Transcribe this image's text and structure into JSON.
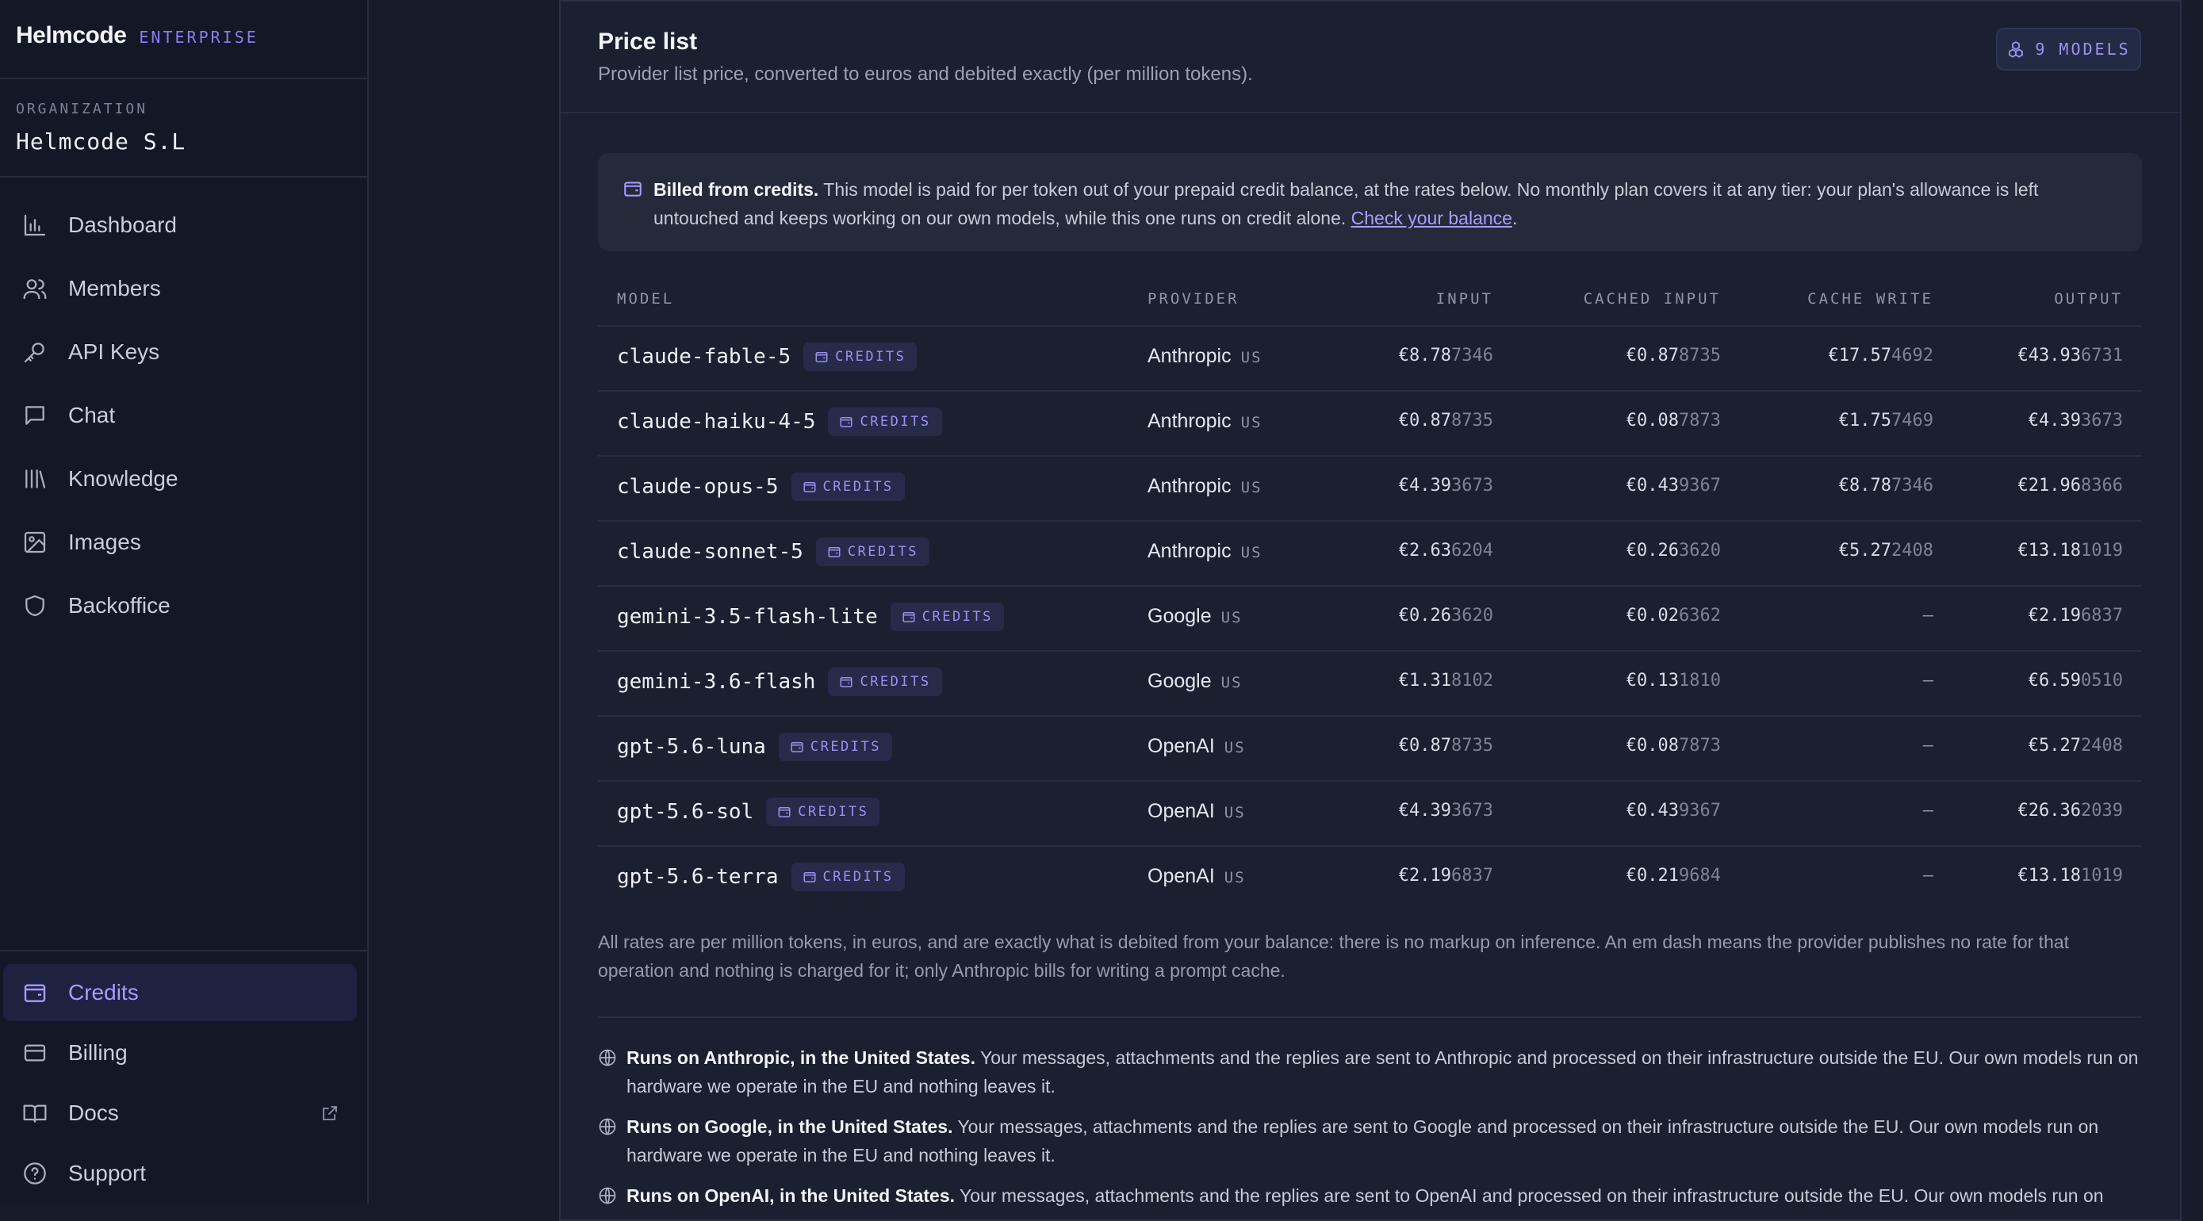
{
  "brand": {
    "name": "Helmcode",
    "tier": "ENTERPRISE"
  },
  "org": {
    "label": "ORGANIZATION",
    "name": "Helmcode S.L"
  },
  "nav": {
    "dashboard": "Dashboard",
    "members": "Members",
    "api_keys": "API Keys",
    "chat": "Chat",
    "knowledge": "Knowledge",
    "images": "Images",
    "backoffice": "Backoffice",
    "credits": "Credits",
    "billing": "Billing",
    "docs": "Docs",
    "support": "Support"
  },
  "colors": {
    "accent": "#a79bff",
    "background": "#161b29",
    "sidebar": "#121826",
    "panel": "#1b2030"
  },
  "price_list": {
    "title": "Price list",
    "subtitle": "Provider list price, converted to euros and debited exactly (per million tokens).",
    "models_badge": "9 MODELS",
    "notice": {
      "bold": "Billed from credits.",
      "text": " This model is paid for per token out of your prepaid credit balance, at the rates below. No monthly plan covers it at any tier: your plan's allowance is left untouched and keeps working on our own models, while this one runs on credit alone. ",
      "link": "Check your balance",
      "end": "."
    },
    "columns": {
      "model": "MODEL",
      "provider": "PROVIDER",
      "input": "INPUT",
      "cached_input": "CACHED INPUT",
      "cache_write": "CACHE WRITE",
      "output": "OUTPUT"
    },
    "badge_label": "CREDITS",
    "rows": [
      {
        "model": "claude-fable-5",
        "provider": "Anthropic",
        "region": "US",
        "input": [
          "€8.78",
          "7346"
        ],
        "cached": [
          "€0.87",
          "8735"
        ],
        "write": [
          "€17.57",
          "4692"
        ],
        "output": [
          "€43.93",
          "6731"
        ]
      },
      {
        "model": "claude-haiku-4-5",
        "provider": "Anthropic",
        "region": "US",
        "input": [
          "€0.87",
          "8735"
        ],
        "cached": [
          "€0.08",
          "7873"
        ],
        "write": [
          "€1.75",
          "7469"
        ],
        "output": [
          "€4.39",
          "3673"
        ]
      },
      {
        "model": "claude-opus-5",
        "provider": "Anthropic",
        "region": "US",
        "input": [
          "€4.39",
          "3673"
        ],
        "cached": [
          "€0.43",
          "9367"
        ],
        "write": [
          "€8.78",
          "7346"
        ],
        "output": [
          "€21.96",
          "8366"
        ]
      },
      {
        "model": "claude-sonnet-5",
        "provider": "Anthropic",
        "region": "US",
        "input": [
          "€2.63",
          "6204"
        ],
        "cached": [
          "€0.26",
          "3620"
        ],
        "write": [
          "€5.27",
          "2408"
        ],
        "output": [
          "€13.18",
          "1019"
        ]
      },
      {
        "model": "gemini-3.5-flash-lite",
        "provider": "Google",
        "region": "US",
        "input": [
          "€0.26",
          "3620"
        ],
        "cached": [
          "€0.02",
          "6362"
        ],
        "write": null,
        "output": [
          "€2.19",
          "6837"
        ]
      },
      {
        "model": "gemini-3.6-flash",
        "provider": "Google",
        "region": "US",
        "input": [
          "€1.31",
          "8102"
        ],
        "cached": [
          "€0.13",
          "1810"
        ],
        "write": null,
        "output": [
          "€6.59",
          "0510"
        ]
      },
      {
        "model": "gpt-5.6-luna",
        "provider": "OpenAI",
        "region": "US",
        "input": [
          "€0.87",
          "8735"
        ],
        "cached": [
          "€0.08",
          "7873"
        ],
        "write": null,
        "output": [
          "€5.27",
          "2408"
        ]
      },
      {
        "model": "gpt-5.6-sol",
        "provider": "OpenAI",
        "region": "US",
        "input": [
          "€4.39",
          "3673"
        ],
        "cached": [
          "€0.43",
          "9367"
        ],
        "write": null,
        "output": [
          "€26.36",
          "2039"
        ]
      },
      {
        "model": "gpt-5.6-terra",
        "provider": "OpenAI",
        "region": "US",
        "input": [
          "€2.19",
          "6837"
        ],
        "cached": [
          "€0.21",
          "9684"
        ],
        "write": null,
        "output": [
          "€13.18",
          "1019"
        ]
      }
    ],
    "dash": "—",
    "footnote": "All rates are per million tokens, in euros, and are exactly what is debited from your balance: there is no markup on inference. An em dash means the provider publishes no rate for that operation and nothing is charged for it; only Anthropic bills for writing a prompt cache.",
    "regions": [
      {
        "bold": "Runs on Anthropic, in the United States.",
        "text": " Your messages, attachments and the replies are sent to Anthropic and processed on their infrastructure outside the EU. Our own models run on hardware we operate in the EU and nothing leaves it."
      },
      {
        "bold": "Runs on Google, in the United States.",
        "text": " Your messages, attachments and the replies are sent to Google and processed on their infrastructure outside the EU. Our own models run on hardware we operate in the EU and nothing leaves it."
      },
      {
        "bold": "Runs on OpenAI, in the United States.",
        "text": " Your messages, attachments and the replies are sent to OpenAI and processed on their infrastructure outside the EU. Our own models run on"
      }
    ]
  }
}
